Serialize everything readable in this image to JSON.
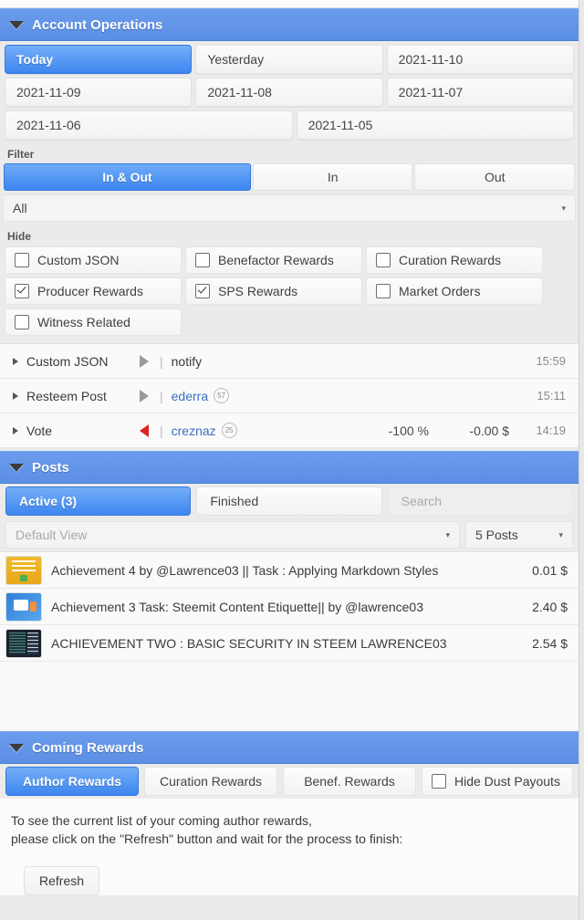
{
  "account_operations": {
    "title": "Account Operations",
    "dates": [
      {
        "label": "Today",
        "active": true
      },
      {
        "label": "Yesterday",
        "active": false
      },
      {
        "label": "2021-11-10",
        "active": false
      },
      {
        "label": "2021-11-09",
        "active": false
      },
      {
        "label": "2021-11-08",
        "active": false
      },
      {
        "label": "2021-11-07",
        "active": false
      },
      {
        "label": "2021-11-06",
        "active": false
      },
      {
        "label": "2021-11-05",
        "active": false
      }
    ],
    "filter_label": "Filter",
    "direction": [
      {
        "label": "In & Out",
        "active": true
      },
      {
        "label": "In",
        "active": false
      },
      {
        "label": "Out",
        "active": false
      }
    ],
    "type_select": {
      "value": "All",
      "arrow": "▾"
    },
    "hide_label": "Hide",
    "hide_options": [
      {
        "label": "Custom JSON",
        "checked": false
      },
      {
        "label": "Benefactor Rewards",
        "checked": false
      },
      {
        "label": "Curation Rewards",
        "checked": false
      },
      {
        "label": "Producer Rewards",
        "checked": true
      },
      {
        "label": "SPS Rewards",
        "checked": true
      },
      {
        "label": "Market Orders",
        "checked": false
      },
      {
        "label": "Witness Related",
        "checked": false
      }
    ],
    "operations": [
      {
        "type": "Custom JSON",
        "direction": "right",
        "target": "notify",
        "link": false,
        "badge": "",
        "percent": "",
        "value": "",
        "time": "15:59"
      },
      {
        "type": "Resteem Post",
        "direction": "right",
        "target": "ederra",
        "link": true,
        "badge": "57",
        "percent": "",
        "value": "",
        "time": "15:11"
      },
      {
        "type": "Vote",
        "direction": "left",
        "target": "creznaz",
        "link": true,
        "badge": "25",
        "percent": "-100 %",
        "value": "-0.00 $",
        "time": "14:19"
      }
    ]
  },
  "posts": {
    "title": "Posts",
    "tabs": [
      {
        "label": "Active (3)",
        "active": true
      },
      {
        "label": "Finished",
        "active": false
      }
    ],
    "search_placeholder": "Search",
    "view_select": {
      "value": "Default View",
      "arrow": "▾"
    },
    "count_select": {
      "value": "5 Posts",
      "arrow": "▾"
    },
    "items": [
      {
        "thumb": "markdown-styles-thumbnail",
        "title": "Achievement 4 by @Lawrence03 || Task : Applying Markdown Styles",
        "value": "0.01 $"
      },
      {
        "thumb": "content-etiquette-thumbnail",
        "title": "Achievement 3 Task: Steemit Content Etiquette|| by @lawrence03",
        "value": "2.40 $"
      },
      {
        "thumb": "basic-security-thumbnail",
        "title": "ACHIEVEMENT TWO : BASIC SECURITY IN STEEM LAWRENCE03",
        "value": "2.54 $"
      }
    ]
  },
  "coming_rewards": {
    "title": "Coming Rewards",
    "tabs": [
      {
        "label": "Author Rewards",
        "active": true
      },
      {
        "label": "Curation Rewards",
        "active": false
      },
      {
        "label": "Benef. Rewards",
        "active": false
      }
    ],
    "hide_dust": {
      "label": "Hide Dust Payouts",
      "checked": false
    },
    "description_line1": "To see the current list of your coming author rewards,",
    "description_line2": "please click on the \"Refresh\" button and wait for the process to finish:",
    "refresh_label": "Refresh"
  },
  "colors": {
    "header_blue": "#5b8fe4",
    "active_blue": "#3d86ef",
    "link_blue": "#3b6fc4",
    "downvote_red": "#dd2222"
  }
}
